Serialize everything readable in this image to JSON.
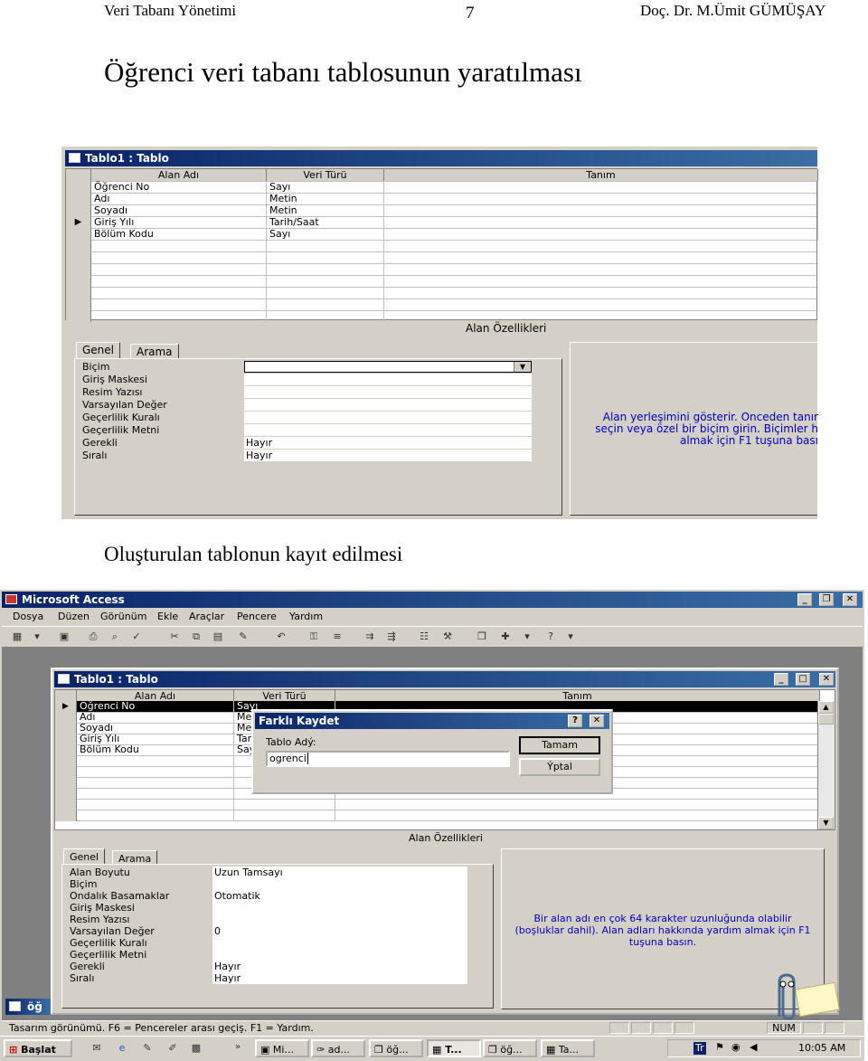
{
  "header": {
    "left": "Veri Tabanı Yönetimi",
    "page": "7",
    "right": "Doç. Dr. M.Ümit GÜMÜŞAY"
  },
  "heading": "Öğrenci veri tabanı tablosunun yaratılması",
  "caption2": "Oluşturulan tablonun kayıt edilmesi",
  "shot1": {
    "title": "Tablo1 : Tablo",
    "columns": [
      "Alan Adı",
      "Veri Türü",
      "Tanım"
    ],
    "rows": [
      {
        "name": "Öğrenci No",
        "type": "Sayı"
      },
      {
        "name": "Adı",
        "type": "Metin"
      },
      {
        "name": "Soyadı",
        "type": "Metin"
      },
      {
        "name": "Giriş Yılı",
        "type": "Tarih/Saat"
      },
      {
        "name": "Bölüm Kodu",
        "type": "Sayı"
      }
    ],
    "section_label": "Alan Özellikleri",
    "tabs": [
      "Genel",
      "Arama"
    ],
    "props": [
      {
        "label": "Biçim",
        "value": ""
      },
      {
        "label": "Giriş Maskesi",
        "value": ""
      },
      {
        "label": "Resim Yazısı",
        "value": ""
      },
      {
        "label": "Varsayılan Değer",
        "value": ""
      },
      {
        "label": "Geçerlilik Kuralı",
        "value": ""
      },
      {
        "label": "Geçerlilik Metni",
        "value": ""
      },
      {
        "label": "Gerekli",
        "value": "Hayır"
      },
      {
        "label": "Sıralı",
        "value": "Hayır"
      }
    ],
    "help": [
      "Alan yerleşimini gösterir. Önceden tanır",
      "seçin veya özel bir biçim girin. Biçimler h",
      "almak için F1 tuşuna bası"
    ]
  },
  "shot2": {
    "app_title": "Microsoft Access",
    "menu": [
      "Dosya",
      "Düzen",
      "Görünüm",
      "Ekle",
      "Araçlar",
      "Pencere",
      "Yardım"
    ],
    "window_title": "Tablo1 : Tablo",
    "columns": [
      "Alan Adı",
      "Veri Türü",
      "Tanım"
    ],
    "rows": [
      {
        "name": "Öğrenci No",
        "type": "Sayı"
      },
      {
        "name": "Adı",
        "type": "Me"
      },
      {
        "name": "Soyadı",
        "type": "Me"
      },
      {
        "name": "Giriş Yılı",
        "type": "Tar"
      },
      {
        "name": "Bölüm Kodu",
        "type": "Say"
      }
    ],
    "dialog": {
      "title": "Farklı Kaydet",
      "label": "Tablo Adý:",
      "value": "ogrenci",
      "ok": "Tamam",
      "cancel": "Ýptal"
    },
    "section_label": "Alan Özellikleri",
    "tabs": [
      "Genel",
      "Arama"
    ],
    "props": [
      {
        "label": "Alan Boyutu",
        "value": "Uzun Tamsayı"
      },
      {
        "label": "Biçim",
        "value": ""
      },
      {
        "label": "Ondalık Basamaklar",
        "value": "Otomatik"
      },
      {
        "label": "Giriş Maskesi",
        "value": ""
      },
      {
        "label": "Resim Yazısı",
        "value": ""
      },
      {
        "label": "Varsayılan Değer",
        "value": "0"
      },
      {
        "label": "Geçerlilik Kuralı",
        "value": ""
      },
      {
        "label": "Geçerlilik Metni",
        "value": ""
      },
      {
        "label": "Gerekli",
        "value": "Hayır"
      },
      {
        "label": "Sıralı",
        "value": "Hayır"
      }
    ],
    "help": [
      "Bir alan adı en çok 64 karakter uzunluğunda olabilir",
      "(boşluklar dahil). Alan adları hakkında yardım almak için F1",
      "tuşuna basın."
    ],
    "status": "Tasarım görünümü.  F6 = Pencereler arası geçiş.  F1 = Yardım.",
    "status_num": "NUM",
    "side_label": "öğ",
    "taskbar": {
      "start": "Başlat",
      "buttons": [
        "Mi...",
        "ad...",
        "öğ...",
        "T...",
        "öğ...",
        "Ta..."
      ],
      "tray_lang": "Tr",
      "time": "10:05 AM"
    }
  }
}
